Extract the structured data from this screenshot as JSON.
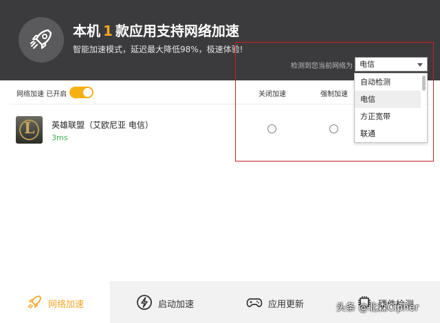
{
  "header": {
    "title_prefix": "本机",
    "title_count": "1",
    "title_suffix": "款应用支持网络加速",
    "subtitle": "智能加速模式，延迟最大降低98%，极速体验!",
    "network_label": "检测到您当前网络为",
    "network_selected": "电信"
  },
  "network_dropdown": {
    "options": [
      "自动检测",
      "电信",
      "方正宽带",
      "联通"
    ],
    "selected_index": 1
  },
  "toolbar": {
    "toggle_label": "网络加速 已开启",
    "toggle_on": true,
    "col_off": "关闭加速",
    "col_force": "强制加速"
  },
  "apps": [
    {
      "name": "英雄联盟（艾欧尼亚 电信）",
      "ping": "3ms",
      "icon": "lol-logo-icon"
    }
  ],
  "nav": {
    "tabs": [
      {
        "label": "网络加速",
        "icon": "rocket-icon",
        "active": true
      },
      {
        "label": "启动加速",
        "icon": "lightning-icon",
        "active": false
      },
      {
        "label": "应用更新",
        "icon": "gamepad-icon",
        "active": false
      },
      {
        "label": "硬件检测",
        "icon": "chip-icon",
        "active": false
      }
    ]
  },
  "watermark": "头条 @北森Cipher",
  "colors": {
    "header_bg": "#3b3b3d",
    "accent": "#f5a623",
    "toggle_on": "#f5b114",
    "ping_green": "#3bb34a",
    "highlight_red": "#d01c1c"
  }
}
